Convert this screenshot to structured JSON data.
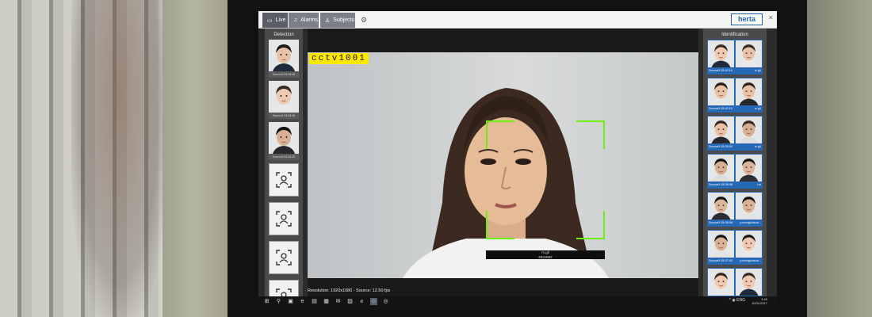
{
  "window": {
    "tabs": [
      {
        "label": "Live",
        "icon": "camera-icon"
      },
      {
        "label": "Alarms",
        "icon": "bell-icon"
      },
      {
        "label": "Subjects",
        "icon": "person-icon"
      }
    ],
    "settings_icon": "gear-icon",
    "brand": "herta",
    "close_glyph": "×"
  },
  "detection": {
    "title": "Detection",
    "items": [
      {
        "caption": "Source3 03:38:08",
        "skin": "#e7c2a6",
        "hair": "#1e1a18",
        "shirt": "#1f2b3a"
      },
      {
        "caption": "Source3 03:36:45",
        "skin": "#efc9b0",
        "hair": "#3a2a22",
        "shirt": "#e8e8e8"
      },
      {
        "caption": "Source3 03:36:29",
        "skin": "#d8b195",
        "hair": "#161412",
        "shirt": "#26272a"
      }
    ],
    "placeholder_count": 4
  },
  "video": {
    "camera_label": "cctv1001",
    "face_name": "m.gil",
    "face_size": "682x682",
    "status": "Resolution: 1920x1080 - Source: 12.50 fps"
  },
  "identification": {
    "title": "Identification",
    "items": [
      {
        "time": "Source3 03:40:15",
        "name": "m.gil"
      },
      {
        "time": "Source3 03:40:10",
        "name": "m.gil"
      },
      {
        "time": "Source3 03:39:00",
        "name": "m.gil"
      },
      {
        "time": "Source3 03:38:48",
        "name": "t.m"
      },
      {
        "time": "Source3 03:38:08",
        "name": "p.mongkolsub..."
      },
      {
        "time": "Source3 03:37:43",
        "name": "p.mongkolsub..."
      },
      {
        "time": "",
        "name": ""
      }
    ]
  },
  "taskbar": {
    "icons": [
      "windows-icon",
      "search-icon",
      "task-view-icon",
      "edge-icon",
      "explorer-icon",
      "store-icon",
      "mail-icon",
      "photos-icon",
      "ie-icon",
      "face-app-icon",
      "app-icon"
    ],
    "tray": "^ ◉ ENG",
    "time": "3:40",
    "date": "10/31/2017"
  }
}
